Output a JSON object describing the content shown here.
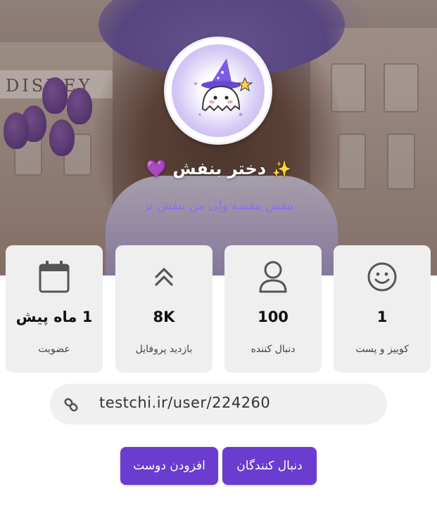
{
  "profile": {
    "name": "دختر بنفش",
    "name_prefix_emoji": "✨",
    "name_suffix_emoji": "💜",
    "bio": "بنفش بنفشه ولی من بنفش تر",
    "cover_sign": "DISNEY"
  },
  "stats": [
    {
      "value": "1",
      "label": "کوییز و پست",
      "icon": "smiley-icon"
    },
    {
      "value": "100",
      "label": "دنبال کننده",
      "icon": "user-icon"
    },
    {
      "value": "8K",
      "label": "بازدید پروفایل",
      "icon": "double-chevron-up-icon"
    },
    {
      "value": "1 ماه پیش",
      "label": "عضویت",
      "icon": "calendar-icon"
    }
  ],
  "link": {
    "url": "testchi.ir/user/224260",
    "icon": "link-icon"
  },
  "buttons": {
    "followers": "دنبال کنندگان",
    "add_friend": "افزودن دوست"
  },
  "colors": {
    "accent": "#6a3ccf",
    "bio": "#8e6cf0",
    "card_bg": "#efefef"
  }
}
